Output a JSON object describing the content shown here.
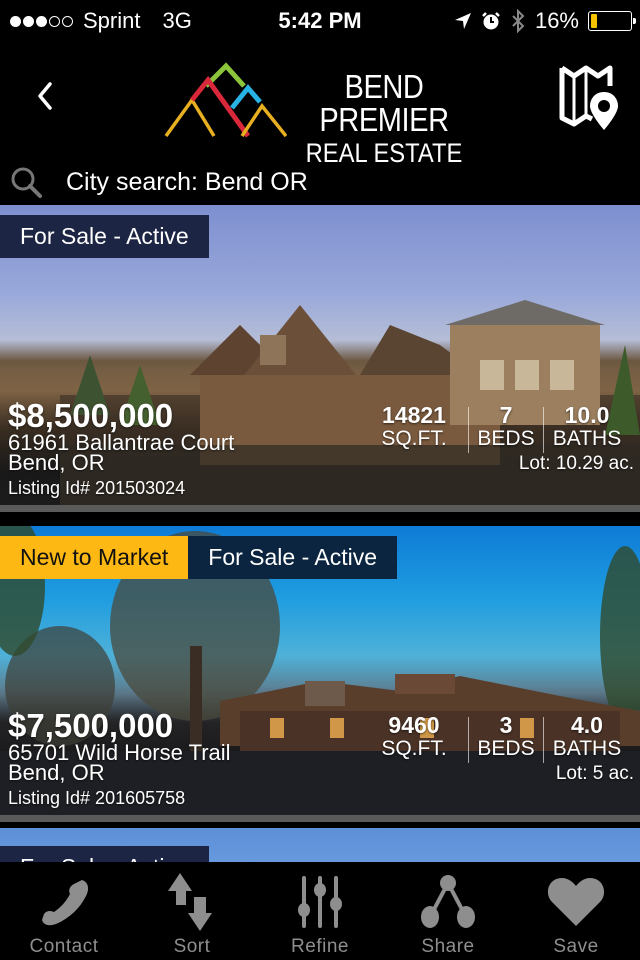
{
  "status_bar": {
    "signal_bars_filled": 3,
    "signal_bars_total": 5,
    "carrier": "Sprint",
    "network": "3G",
    "time": "5:42 PM",
    "battery_percent_label": "16%",
    "battery_level": 0.16,
    "battery_color": "#f7c300"
  },
  "header": {
    "back_icon": "chevron-left-icon",
    "logo_line1": "BEND PREMIER",
    "logo_line2": "REAL ESTATE",
    "logo_colors": {
      "left_peak": "#e8b020",
      "center_peak": "#d8283a",
      "top_peak": "#8cc43c",
      "right_peak": "#27b4e4",
      "far_right_peak": "#e8b020"
    },
    "map_icon": "map-pin-icon"
  },
  "search": {
    "icon": "search-icon",
    "text": "City search: Bend OR"
  },
  "listings": [
    {
      "badges": [
        {
          "label": "For Sale - Active",
          "type": "status"
        }
      ],
      "price": "$8,500,000",
      "address_line1": "61961 Ballantrae Court",
      "address_line2": "Bend, OR",
      "listing_id": "Listing Id# 201503024",
      "sqft_value": "14821",
      "sqft_label": "SQ.FT.",
      "beds_value": "7",
      "beds_label": "BEDS",
      "baths_value": "10.0",
      "baths_label": "BATHS",
      "lot": "Lot: 10.29 ac."
    },
    {
      "badges": [
        {
          "label": "New to Market",
          "type": "new"
        },
        {
          "label": "For Sale - Active",
          "type": "status"
        }
      ],
      "price": "$7,500,000",
      "address_line1": "65701 Wild Horse Trail",
      "address_line2": "Bend, OR",
      "listing_id": "Listing Id# 201605758",
      "sqft_value": "9460",
      "sqft_label": "SQ.FT.",
      "beds_value": "3",
      "beds_label": "BEDS",
      "baths_value": "4.0",
      "baths_label": "BATHS",
      "lot": "Lot: 5 ac."
    },
    {
      "badges": [
        {
          "label": "For Sale - Active",
          "type": "status"
        }
      ]
    }
  ],
  "tab_bar": {
    "tabs": [
      {
        "label": "Contact",
        "icon": "phone-icon"
      },
      {
        "label": "Sort",
        "icon": "sort-arrows-icon"
      },
      {
        "label": "Refine",
        "icon": "sliders-icon"
      },
      {
        "label": "Share",
        "icon": "share-nodes-icon"
      },
      {
        "label": "Save",
        "icon": "heart-icon"
      }
    ],
    "icon_color": "#8e8e8e"
  },
  "colors": {
    "badge_new": "#fdb813",
    "badge_status": "#1d2544",
    "separator": "#5a5a5a"
  }
}
